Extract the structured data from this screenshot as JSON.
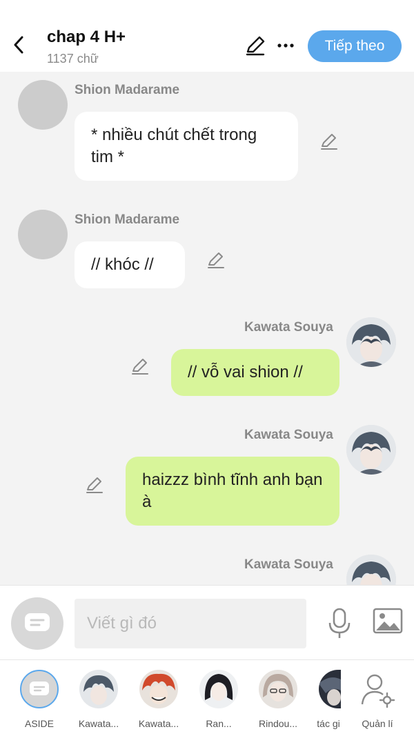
{
  "header": {
    "title": "chap 4 H+",
    "word_count": "1137 chữ",
    "next_label": "Tiếp theo"
  },
  "messages": [
    {
      "sender": "Shion Madarame",
      "text": "* nhiều chút chết trong tim *",
      "side": "left"
    },
    {
      "sender": "Shion Madarame",
      "text": "// khóc //",
      "side": "left"
    },
    {
      "sender": "Kawata Souya",
      "text": "// vỗ vai shion //",
      "side": "right"
    },
    {
      "sender": "Kawata Souya",
      "text": "haizzz bình tĩnh anh bạn à",
      "side": "right"
    },
    {
      "sender": "Kawata Souya",
      "text": "",
      "side": "right"
    }
  ],
  "composer": {
    "placeholder": "Viết gì đó"
  },
  "characters": [
    {
      "label": "ASIDE"
    },
    {
      "label": "Kawata..."
    },
    {
      "label": "Kawata..."
    },
    {
      "label": "Ran..."
    },
    {
      "label": "Rindou..."
    },
    {
      "label": "tác gi"
    },
    {
      "label": "Quản lí"
    }
  ],
  "colors": {
    "accent": "#5ba8ec",
    "right_bubble": "#d8f59a",
    "left_bubble": "#ffffff",
    "background": "#f3f3f3"
  }
}
